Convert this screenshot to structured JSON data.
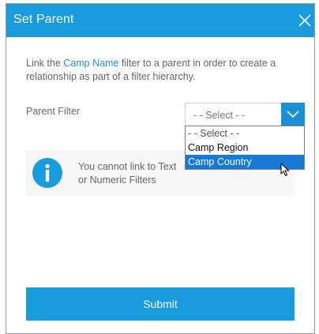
{
  "dialog": {
    "title": "Set Parent",
    "close_icon": "close-icon"
  },
  "description": {
    "prefix": "Link the ",
    "link_text": "Camp Name",
    "suffix": " filter to a parent in order to create a relationship as part of a filter hierarchy."
  },
  "parent_filter": {
    "label": "Parent Filter",
    "selected_value": "- - Select - -",
    "dropdown_icon": "chevron-down-icon",
    "options": [
      {
        "label": "- - Select - -"
      },
      {
        "label": "Camp Region"
      },
      {
        "label": "Camp Country",
        "highlighted": true
      }
    ]
  },
  "notice": {
    "icon": "info-icon",
    "message": "You cannot link to Text\nor Numeric Filters"
  },
  "submit": {
    "label": "Submit"
  },
  "colors": {
    "accent": "#189cde",
    "link": "#1e93cf",
    "selection": "#1779d6"
  }
}
